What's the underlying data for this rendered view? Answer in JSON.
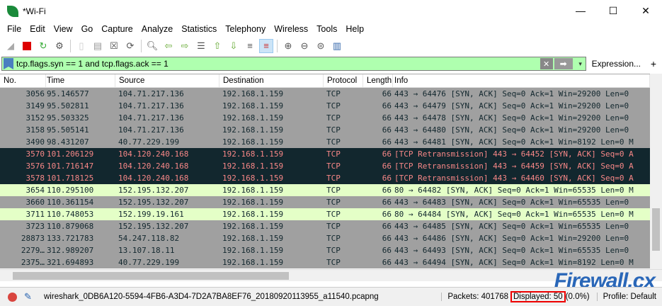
{
  "window": {
    "title": "*Wi-Fi",
    "minimize": "—",
    "maximize": "☐",
    "close": "✕"
  },
  "menu": [
    "File",
    "Edit",
    "View",
    "Go",
    "Capture",
    "Analyze",
    "Statistics",
    "Telephony",
    "Wireless",
    "Tools",
    "Help"
  ],
  "filter": {
    "value": "tcp.flags.syn == 1 and tcp.flags.ack == 1",
    "clear": "✕",
    "apply": "➡",
    "dropdown": "▾",
    "expression": "Expression...",
    "add": "+"
  },
  "columns": [
    "No.",
    "Time",
    "Source",
    "Destination",
    "Protocol",
    "Length",
    "Info"
  ],
  "rows": [
    {
      "style": "gray",
      "no": "3056",
      "time": "95.146577",
      "src": "104.71.217.136",
      "dst": "192.168.1.159",
      "proto": "TCP",
      "len": "66",
      "info": "443 → 64476 [SYN, ACK] Seq=0 Ack=1 Win=29200 Len=0"
    },
    {
      "style": "gray",
      "no": "3149",
      "time": "95.502811",
      "src": "104.71.217.136",
      "dst": "192.168.1.159",
      "proto": "TCP",
      "len": "66",
      "info": "443 → 64479 [SYN, ACK] Seq=0 Ack=1 Win=29200 Len=0"
    },
    {
      "style": "gray",
      "no": "3152",
      "time": "95.503325",
      "src": "104.71.217.136",
      "dst": "192.168.1.159",
      "proto": "TCP",
      "len": "66",
      "info": "443 → 64478 [SYN, ACK] Seq=0 Ack=1 Win=29200 Len=0"
    },
    {
      "style": "gray",
      "no": "3158",
      "time": "95.505141",
      "src": "104.71.217.136",
      "dst": "192.168.1.159",
      "proto": "TCP",
      "len": "66",
      "info": "443 → 64480 [SYN, ACK] Seq=0 Ack=1 Win=29200 Len=0"
    },
    {
      "style": "gray",
      "no": "3490",
      "time": "98.431207",
      "src": "40.77.229.199",
      "dst": "192.168.1.159",
      "proto": "TCP",
      "len": "66",
      "info": "443 → 64481 [SYN, ACK] Seq=0 Ack=1 Win=8192 Len=0 M"
    },
    {
      "style": "dark",
      "no": "3570",
      "time": "101.206129",
      "src": "104.120.240.168",
      "dst": "192.168.1.159",
      "proto": "TCP",
      "len": "66",
      "info": "[TCP Retransmission] 443 → 64452 [SYN, ACK] Seq=0 A"
    },
    {
      "style": "dark",
      "no": "3576",
      "time": "101.716147",
      "src": "104.120.240.168",
      "dst": "192.168.1.159",
      "proto": "TCP",
      "len": "66",
      "info": "[TCP Retransmission] 443 → 64459 [SYN, ACK] Seq=0 A"
    },
    {
      "style": "dark",
      "no": "3578",
      "time": "101.718125",
      "src": "104.120.240.168",
      "dst": "192.168.1.159",
      "proto": "TCP",
      "len": "66",
      "info": "[TCP Retransmission] 443 → 64460 [SYN, ACK] Seq=0 A"
    },
    {
      "style": "green",
      "no": "3654",
      "time": "110.295100",
      "src": "152.195.132.207",
      "dst": "192.168.1.159",
      "proto": "TCP",
      "len": "66",
      "info": "80 → 64482 [SYN, ACK] Seq=0 Ack=1 Win=65535 Len=0 M"
    },
    {
      "style": "gray",
      "no": "3660",
      "time": "110.361154",
      "src": "152.195.132.207",
      "dst": "192.168.1.159",
      "proto": "TCP",
      "len": "66",
      "info": "443 → 64483 [SYN, ACK] Seq=0 Ack=1 Win=65535 Len=0"
    },
    {
      "style": "green",
      "no": "3711",
      "time": "110.748053",
      "src": "152.199.19.161",
      "dst": "192.168.1.159",
      "proto": "TCP",
      "len": "66",
      "info": "80 → 64484 [SYN, ACK] Seq=0 Ack=1 Win=65535 Len=0 M"
    },
    {
      "style": "gray",
      "no": "3723",
      "time": "110.879068",
      "src": "152.195.132.207",
      "dst": "192.168.1.159",
      "proto": "TCP",
      "len": "66",
      "info": "443 → 64485 [SYN, ACK] Seq=0 Ack=1 Win=65535 Len=0"
    },
    {
      "style": "gray",
      "no": "28873",
      "time": "133.721783",
      "src": "54.247.118.82",
      "dst": "192.168.1.159",
      "proto": "TCP",
      "len": "66",
      "info": "443 → 64486 [SYN, ACK] Seq=0 Ack=1 Win=29200 Len=0"
    },
    {
      "style": "gray",
      "no": "2279…",
      "time": "312.989207",
      "src": "13.107.18.11",
      "dst": "192.168.1.159",
      "proto": "TCP",
      "len": "66",
      "info": "443 → 64493 [SYN, ACK] Seq=0 Ack=1 Win=65535 Len=0"
    },
    {
      "style": "gray",
      "no": "2375…",
      "time": "321.694893",
      "src": "40.77.229.199",
      "dst": "192.168.1.159",
      "proto": "TCP",
      "len": "66",
      "info": "443 → 64494 [SYN, ACK] Seq=0 Ack=1 Win=8192 Len=0 M"
    }
  ],
  "status": {
    "file": "wireshark_0DB6A120-5594-4FB6-A3D4-7D2A7BA8EF76_20180920113955_a11540.pcapng",
    "packets": "Packets: 401768",
    "displayed": "Displayed: 50",
    "percent": "(0.0%)",
    "profile": "Profile: Default"
  },
  "watermark": "Firewall.cx",
  "colors": {
    "gray_row": "#a0a0a0",
    "dark_row": "#12272e",
    "dark_text": "#f78787",
    "green_row": "#e4ffc7",
    "filter_bg": "#afffaf"
  }
}
